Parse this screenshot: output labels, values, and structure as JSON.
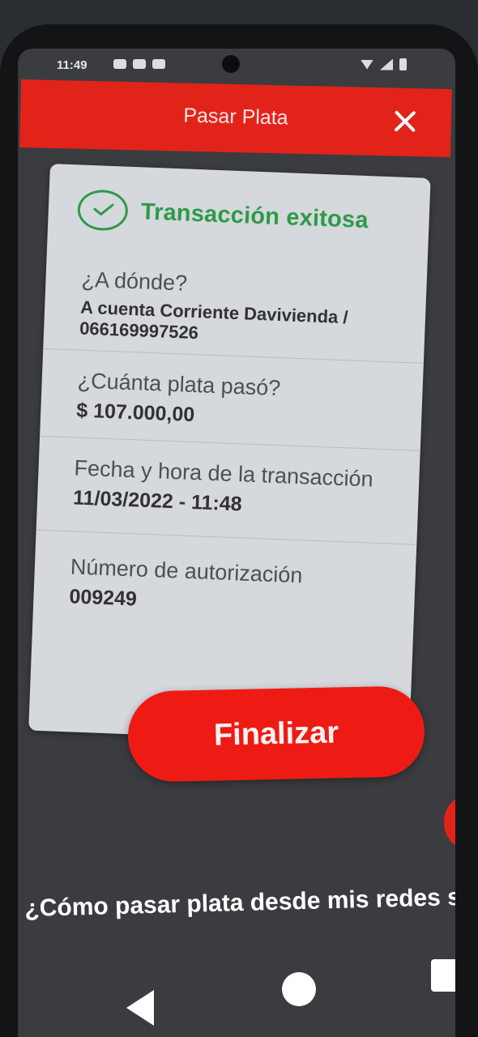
{
  "status_bar": {
    "time": "11:49"
  },
  "header": {
    "title": "Pasar Plata",
    "close_icon": "close-icon",
    "color": "#e2231a"
  },
  "receipt": {
    "status_text": "Transacción exitosa",
    "status_icon": "check-circle-icon",
    "success_color": "#2e9a49",
    "destination": {
      "label": "¿A dónde?",
      "value": "A cuenta Corriente Davivienda / 066169997526"
    },
    "amount": {
      "label": "¿Cuánta plata pasó?",
      "value": "$ 107.000,00"
    },
    "datetime": {
      "label": "Fecha y hora de la transacción",
      "value": "11/03/2022 - 11:48"
    },
    "authorization": {
      "label": "Número de autorización",
      "value": "009249"
    }
  },
  "actions": {
    "finalize_label": "Finalizar",
    "button_color": "#ee1b14"
  },
  "promo": {
    "text": "¿Cómo pasar plata desde mis redes soc"
  },
  "nav_bar": {
    "back_icon": "back-icon",
    "home_icon": "home-icon",
    "recents_icon": "recents-icon"
  }
}
